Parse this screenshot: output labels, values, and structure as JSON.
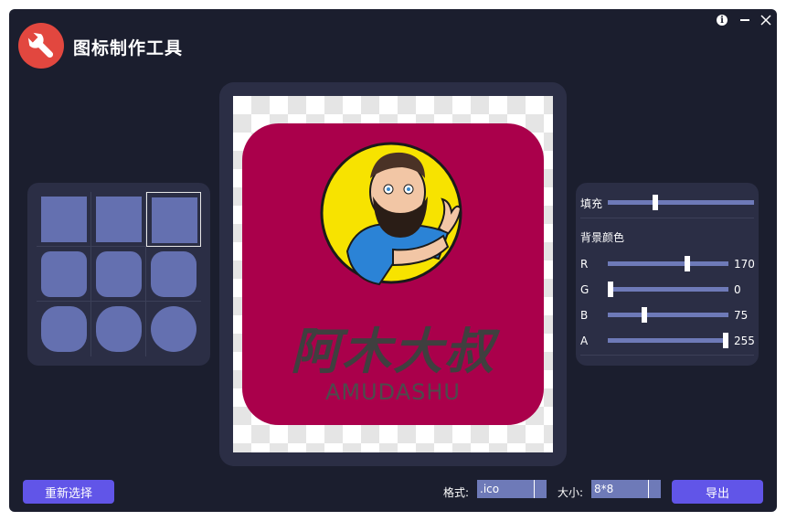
{
  "app": {
    "title": "图标制作工具",
    "logo_icon": "wrench-icon",
    "window_icons": [
      "info-icon",
      "minimize-icon",
      "close-icon"
    ]
  },
  "shapes": {
    "selected_index": 2,
    "radii_percent": [
      0,
      0,
      0,
      20,
      24,
      28,
      36,
      44,
      50
    ]
  },
  "preview": {
    "background_color": "#aa004b",
    "brand_cn": "阿木大叔",
    "brand_en": "AMUDASHU"
  },
  "adjust": {
    "fill_label": "填充",
    "fill_value_fraction": 0.33,
    "bg_color_label": "背景颜色",
    "channels": [
      {
        "label": "R",
        "value": "170"
      },
      {
        "label": "G",
        "value": "0"
      },
      {
        "label": "B",
        "value": "75"
      },
      {
        "label": "A",
        "value": "255"
      }
    ]
  },
  "footer": {
    "reselect_label": "重新选择",
    "format_label": "格式:",
    "format_value": ".ico",
    "size_label": "大小:",
    "size_value": "8*8",
    "export_label": "导出"
  },
  "colors": {
    "window_bg": "#1b1e2e",
    "panel_bg": "#2b2e45",
    "accent": "#6155e8",
    "slider": "#6e7ab8",
    "shape": "#6470b0",
    "logo": "#e2473f"
  }
}
